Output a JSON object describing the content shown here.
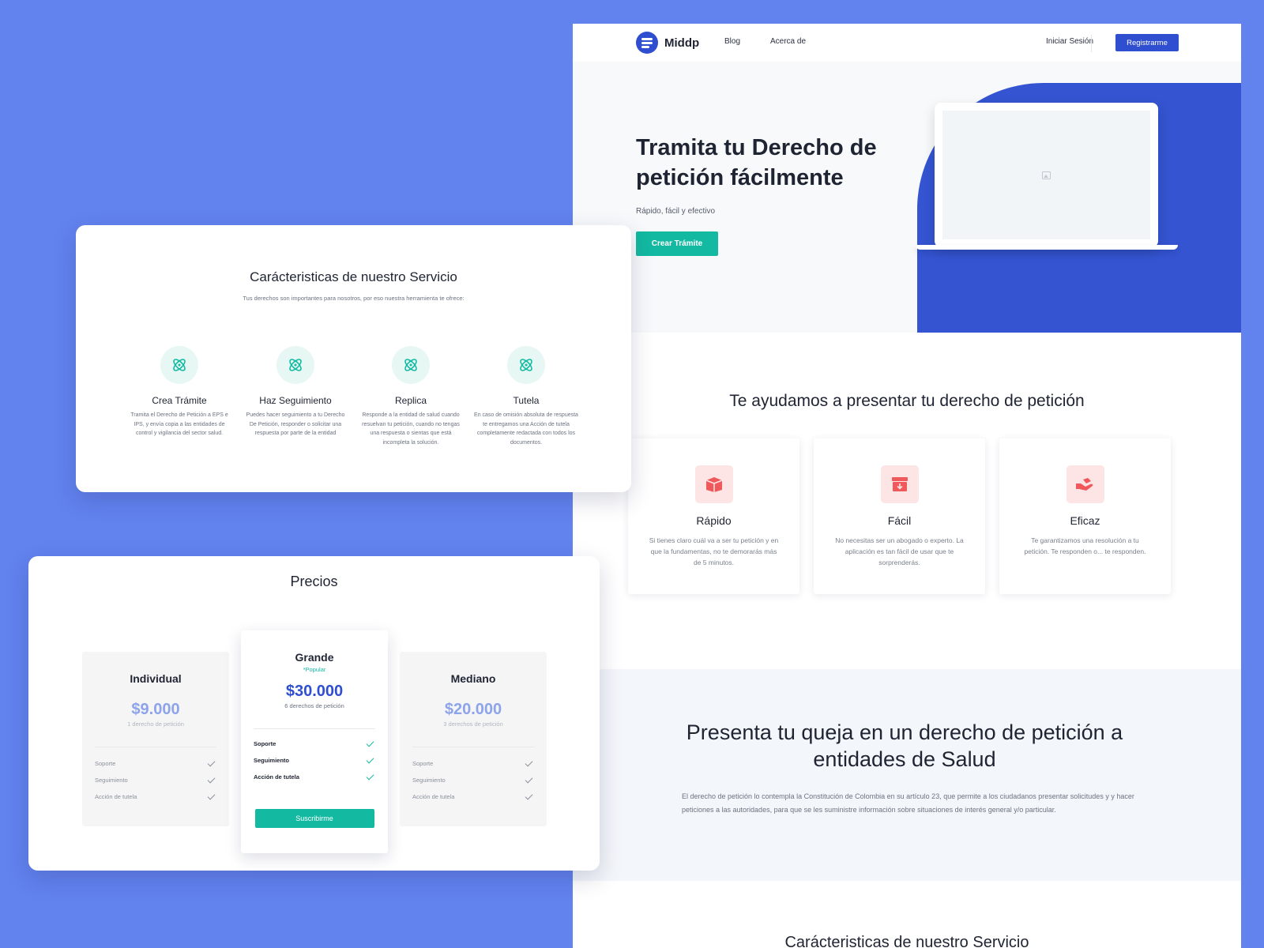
{
  "nav": {
    "brand": "Middp",
    "links": [
      "Blog",
      "Acerca de"
    ],
    "login": "Iniciar Sesión",
    "register": "Registrarme"
  },
  "hero": {
    "title": "Tramita tu Derecho de petición fácilmente",
    "subtitle": "Rápido, fácil y efectivo",
    "cta": "Crear Trámite"
  },
  "help": {
    "title": "Te ayudamos a presentar tu derecho de petición",
    "cards": [
      {
        "icon": "box-icon",
        "title": "Rápido",
        "text": "Si tienes claro cuál va a ser tu petición y en que la fundamentas, no te demorarás más de 5 minutos."
      },
      {
        "icon": "archive-download-icon",
        "title": "Fácil",
        "text": "No necesitas ser un abogado o experto. La aplicación es tan fácil de usar que te sorprenderás."
      },
      {
        "icon": "hand-holding-icon",
        "title": "Eficaz",
        "text": "Te garantizamos una resolución a tu petición. Te responden o... te responden."
      }
    ]
  },
  "queja": {
    "title": "Presenta tu queja en un derecho de petición a entidades de Salud",
    "text": "El derecho de petición lo contempla la Constitución de Colombia en su artículo 23, que permite a los ciudadanos presentar solicitudes y y hacer peticiones a las autoridades, para que se les suministre información sobre situaciones de interés general y/o particular."
  },
  "bottom": {
    "title": "Carácteristicas de nuestro Servicio"
  },
  "features": {
    "title": "Carácteristicas de nuestro Servicio",
    "subtitle": "Tus derechos son importantes para nosotros, por eso nuestra herramienta te ofrece:",
    "items": [
      {
        "title": "Crea Trámite",
        "text": "Tramita el Derecho de Petición a EPS e IPS, y envía copia a las entidades de control y vigilancia del sector salud."
      },
      {
        "title": "Haz Seguimiento",
        "text": "Puedes hacer seguimiento a tu Derecho De Petición, responder o solicitar una respuesta por parte de la entidad"
      },
      {
        "title": "Replica",
        "text": "Responde a la entidad de salud cuando resuelvan tu petición, cuando no tengas una respuesta o sientas que está incompleta la solución."
      },
      {
        "title": "Tutela",
        "text": "En caso de omisión absoluta de respuesta te entregamos una Acción de tutela completamente redactada con todos los documentos."
      }
    ]
  },
  "pricing": {
    "title": "Precios",
    "plans": [
      {
        "name": "Individual",
        "price": "$9.000",
        "count": "1 derecho de petición",
        "features": [
          "Soporte",
          "Seguimiento",
          "Acción de tutela"
        ]
      },
      {
        "name": "Grande",
        "popular": "*Popular",
        "price": "$30.000",
        "count": "6 derechos de petición",
        "features": [
          "Soporte",
          "Seguimiento",
          "Acción de tutela"
        ],
        "cta": "Suscribirme"
      },
      {
        "name": "Mediano",
        "price": "$20.000",
        "count": "3 derechos de petición",
        "features": [
          "Soporte",
          "Seguimiento",
          "Acción de tutela"
        ]
      }
    ]
  },
  "colors": {
    "background": "#6282ee",
    "primary": "#2f4ed0",
    "accent": "#13b9a1",
    "icon_red": "#f0595c"
  }
}
